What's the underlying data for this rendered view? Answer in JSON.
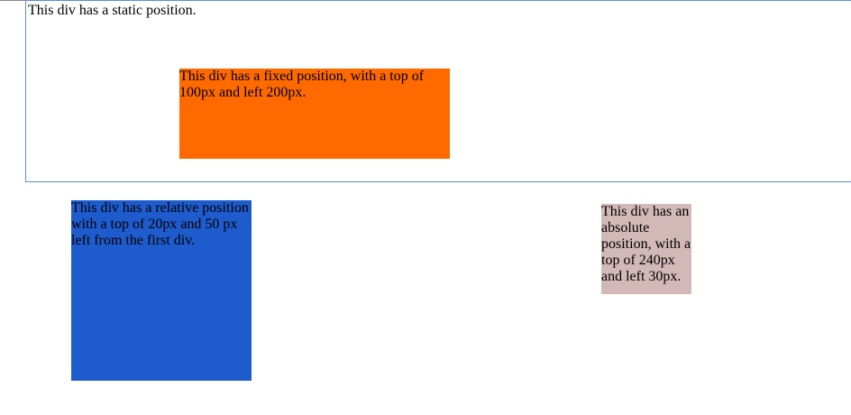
{
  "static_div": {
    "text": "This div has a static position.",
    "border_color": "#5a8ee8"
  },
  "fixed_div": {
    "text": "This div has a fixed position, with a top of 100px and left 200px.",
    "background": "#ff6a00"
  },
  "relative_div": {
    "text": "This div has a relative position with a top of 20px and 50 px left from the first div.",
    "background": "#1e5bcc"
  },
  "absolute_div": {
    "text": "This div has an absolute position, with a top of 240px and left 30px.",
    "background": "#d3b8b8"
  }
}
